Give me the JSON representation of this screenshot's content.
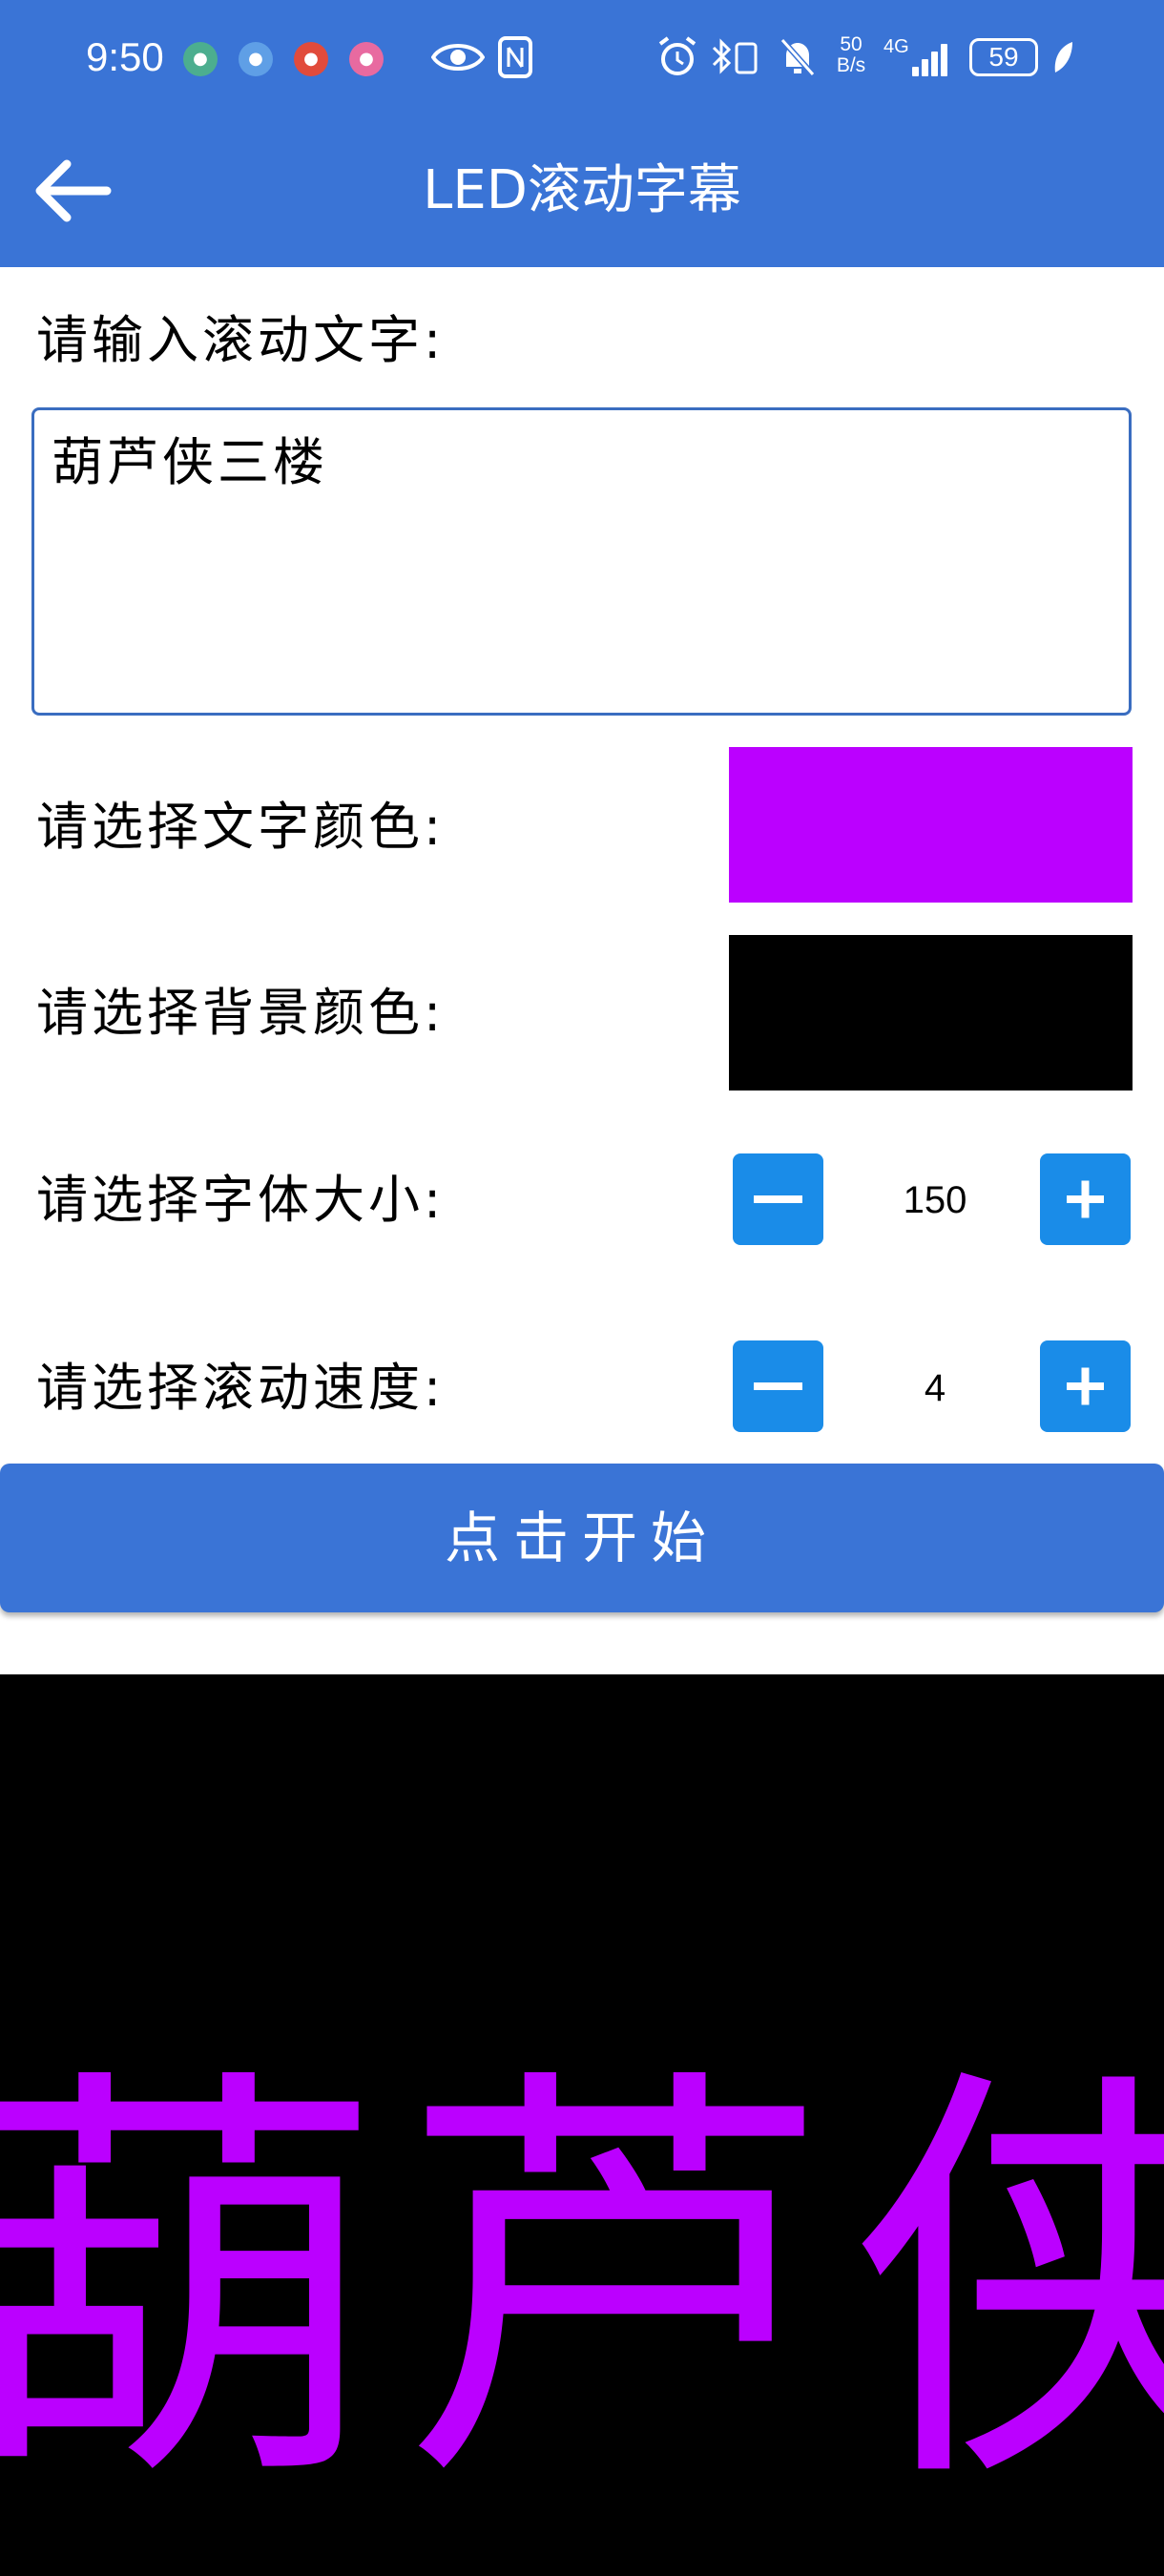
{
  "status_bar": {
    "time": "9:50",
    "app_icons": [
      {
        "name": "app-icon-1",
        "color": "#4cae8f"
      },
      {
        "name": "app-icon-2",
        "color": "#5f9fe6"
      },
      {
        "name": "app-icon-3",
        "color": "#e14b3b"
      },
      {
        "name": "app-icon-4",
        "color": "#e86aa0"
      }
    ],
    "net_speed_value": "50",
    "net_speed_unit": "B/s",
    "network_type": "4G",
    "battery": "59"
  },
  "header": {
    "title": "LED滚动字幕",
    "back_icon": "arrow-left-icon"
  },
  "form": {
    "text_label": "请输入滚动文字:",
    "text_value": "葫芦侠三楼",
    "text_color_label": "请选择文字颜色:",
    "text_color": "#bb00ff",
    "bg_color_label": "请选择背景颜色:",
    "bg_color": "#000000",
    "font_size_label": "请选择字体大小:",
    "font_size_value": "150",
    "speed_label": "请选择滚动速度:",
    "speed_value": "4",
    "start_label": "点击开始"
  },
  "preview": {
    "text": "葫芦侠三楼"
  },
  "colors": {
    "accent": "#3a74d6",
    "stepper_button": "#1a8ce8"
  }
}
